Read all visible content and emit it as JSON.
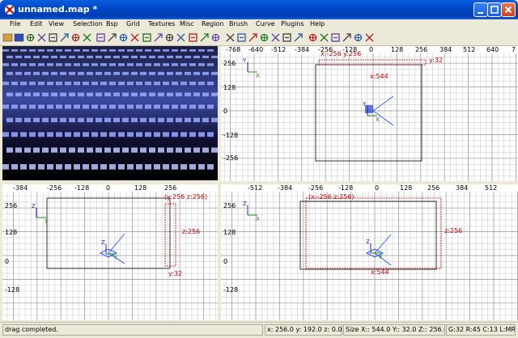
{
  "window": {
    "title": "unnamed.map *"
  },
  "menu": [
    "File",
    "Edit",
    "View",
    "Selection",
    "Bsp",
    "Grid",
    "Textures",
    "Misc",
    "Region",
    "Brush",
    "Curve",
    "Plugins",
    "Help"
  ],
  "toolbar_icons": [
    "open-icon",
    "save-icon",
    "flip-x-icon",
    "flip-y-icon",
    "flip-z-icon",
    "rotate-x-icon",
    "rotate-y-icon",
    "rotate-z-icon",
    "select-complete-icon",
    "select-touching-icon",
    "select-partial-icon",
    "select-inside-icon",
    "csg-subtract-icon",
    "csg-merge-icon",
    "hollow-icon",
    "clipper-icon",
    "change-view-icon",
    "texture-lock-icon",
    "scale-lock-icon",
    "camera-icon",
    "vertex-icon",
    "x-axis-icon",
    "y-axis-icon",
    "z-axis-icon",
    "entity-icon",
    "patch-icon",
    "cap-icon",
    "bend-icon",
    "drag-icon",
    "scale-icon",
    "rotate-icon",
    "preferences-icon"
  ],
  "views": {
    "xy": {
      "hticks": [
        "-768",
        "-640",
        "-512",
        "-384",
        "-256",
        "-128",
        "0",
        "128",
        "256",
        "384",
        "512",
        "640",
        "7"
      ],
      "vticks": [
        "256",
        "128",
        "0",
        "-128",
        "-256"
      ],
      "labels": {
        "top": "x:-256  y:256",
        "y": "y:32",
        "x": "x:544"
      }
    },
    "xz": {
      "hticks": [
        "-384",
        "-256",
        "-128",
        "0",
        "128",
        "256"
      ],
      "vticks": [
        "256",
        "128",
        "0",
        "-128"
      ],
      "labels": {
        "top": "(y:256  z:256)",
        "z": "z:256",
        "y": "y:32"
      }
    },
    "yz": {
      "hticks": [
        "-512",
        "-384",
        "-256",
        "-128",
        "0",
        "128",
        "256",
        "384",
        "512"
      ],
      "vticks": [
        "256",
        "128",
        "0",
        "-128"
      ],
      "labels": {
        "top": "(x:-256  z:256)",
        "z": "z:256",
        "x": "x:544"
      }
    }
  },
  "status": {
    "message": "drag completed.",
    "coords": "x: 256.0  y: 192.0  z: 0.0",
    "size": "Size X:: 544.0  Y:: 32.0  Z:: 256.0",
    "grid": "G:32 R:45 C:13 L:MR"
  },
  "colors": {
    "accent": "#0054e3",
    "selection": "#cc0000",
    "grid": "#c8c8c8"
  }
}
